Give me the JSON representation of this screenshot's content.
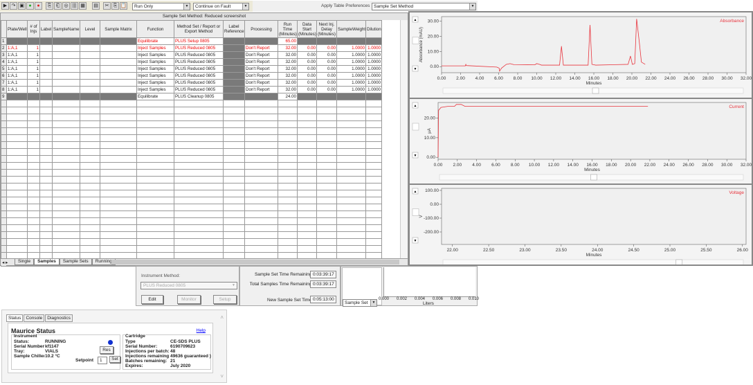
{
  "toolbar": {
    "icons": [
      "start-icon",
      "step-icon",
      "save-icon",
      "go-green-icon",
      "stop-red-icon",
      "copy-icon",
      "paste-row-icon",
      "find-icon",
      "columns-icon",
      "grid-icon",
      "calculator-icon",
      "cut-icon",
      "copy2-icon",
      "paste-icon"
    ],
    "run_mode": "Run Only",
    "fault_mode": "Continue on Fault",
    "apply_prefs_label": "Apply Table Preferences",
    "prefs_value": "Sample Set Method"
  },
  "table": {
    "title": "Sample Set Method: Reduced screenshot",
    "columns": [
      "",
      "Plate/Well",
      "# of Injs",
      "Label",
      "SampleName",
      "Level",
      "Sample Matrix",
      "Function",
      "Method Set / Report or Export Method",
      "Label Reference",
      "Processing",
      "Run Time (Minutes)",
      "Data Start (Minutes)",
      "Next Inj. Delay (Minutes)",
      "SampleWeight",
      "Dilution"
    ],
    "rows": [
      {
        "n": "1",
        "well": "",
        "inj": "",
        "func": "Equilibrate",
        "method": "PLUS Setup 0805",
        "proc": "",
        "run": "65.00",
        "start": "",
        "delay": "",
        "weight": "",
        "dil": "",
        "style": "equil-red"
      },
      {
        "n": "2",
        "well": "1:A,1",
        "inj": "1",
        "func": "Inject Samples",
        "method": "PLUS Reduced 0805",
        "proc": "Don't Report",
        "run": "32.00",
        "start": "0.00",
        "delay": "0.00",
        "weight": "1.0000",
        "dil": "1.0000",
        "style": "red"
      },
      {
        "n": "3",
        "well": "1:A,1",
        "inj": "1",
        "func": "Inject Samples",
        "method": "PLUS Reduced 0805",
        "proc": "Don't Report",
        "run": "32.00",
        "start": "0.00",
        "delay": "0.00",
        "weight": "1.0000",
        "dil": "1.0000",
        "style": ""
      },
      {
        "n": "4",
        "well": "1:A,1",
        "inj": "1",
        "func": "Inject Samples",
        "method": "PLUS Reduced 0805",
        "proc": "Don't Report",
        "run": "32.00",
        "start": "0.00",
        "delay": "0.00",
        "weight": "1.0000",
        "dil": "1.0000",
        "style": ""
      },
      {
        "n": "5",
        "well": "1:A,1",
        "inj": "1",
        "func": "Inject Samples",
        "method": "PLUS Reduced 0805",
        "proc": "Don't Report",
        "run": "32.00",
        "start": "0.00",
        "delay": "0.00",
        "weight": "1.0000",
        "dil": "1.0000",
        "style": ""
      },
      {
        "n": "6",
        "well": "1:A,1",
        "inj": "1",
        "func": "Inject Samples",
        "method": "PLUS Reduced 0805",
        "proc": "Don't Report",
        "run": "32.00",
        "start": "0.00",
        "delay": "0.00",
        "weight": "1.0000",
        "dil": "1.0000",
        "style": ""
      },
      {
        "n": "7",
        "well": "1:A,1",
        "inj": "1",
        "func": "Inject Samples",
        "method": "PLUS Reduced 0805",
        "proc": "Don't Report",
        "run": "32.00",
        "start": "0.00",
        "delay": "0.00",
        "weight": "1.0000",
        "dil": "1.0000",
        "style": ""
      },
      {
        "n": "8",
        "well": "1:A,1",
        "inj": "1",
        "func": "Inject Samples",
        "method": "PLUS Reduced 0805",
        "proc": "Don't Report",
        "run": "32.00",
        "start": "0.00",
        "delay": "0.00",
        "weight": "1.0000",
        "dil": "1.0000",
        "style": ""
      },
      {
        "n": "9",
        "well": "",
        "inj": "",
        "func": "Equilibrate",
        "method": "PLUS Cleanup 0805",
        "proc": "",
        "run": "24.00",
        "start": "",
        "delay": "",
        "weight": "",
        "dil": "",
        "style": "equil"
      }
    ],
    "sheet_tabs": [
      "Single",
      "Samples",
      "Sample Sets",
      "Running"
    ],
    "active_tab": "Samples"
  },
  "instrument": {
    "method_label": "Instrument Method:",
    "method_value": "PLUS Reduced 0805",
    "edit": "Edit",
    "monitor": "Monitor",
    "setup": "Setup",
    "set_time_label": "Sample Set Time Remaining:",
    "set_time": "0:03:39:17",
    "total_time_label": "Total Samples Time Remaining:",
    "total_time": "0:03:39:17",
    "new_time_label": "New Sample Set Time:",
    "new_time": "0:05:13:00",
    "volume_select": "Sample Set",
    "volume_ticks": [
      "0.000",
      "0.002",
      "0.004",
      "0.006",
      "0.008",
      "0.010"
    ],
    "volume_axis": "Liters"
  },
  "status": {
    "tabs": [
      "Status",
      "Console",
      "Diagnostics"
    ],
    "title": "Maurice Status",
    "help": "Help",
    "instrument_heading": "Instrument",
    "instrument": [
      [
        "Status:",
        "RUNNING"
      ],
      [
        "Serial Number:",
        "kf1147"
      ],
      [
        "Tray:",
        "VIALS"
      ],
      [
        "Sample Chiller:",
        "10.2 °C"
      ]
    ],
    "status_color": "#1030d0",
    "res": "Res",
    "setpoint_label": "Setpoint",
    "setpoint_value": "1",
    "set": "Set",
    "cartridge_heading": "Cartridge",
    "cartridge": [
      [
        "Type",
        "CE-SDS PLUS"
      ],
      [
        "Serial Number:",
        "6190709623"
      ],
      [
        "Injections per batch:",
        "48"
      ],
      [
        "Injections remaining:",
        "49636 guaranteed )"
      ],
      [
        "Batches remaining:",
        "21"
      ],
      [
        "Expires:",
        "July 2020"
      ]
    ]
  },
  "chart_data": [
    {
      "type": "line",
      "series": [
        {
          "name": "Absorbance",
          "x": [
            0,
            2.5,
            2.55,
            2.6,
            5.8,
            6.05,
            6.1,
            6.3,
            6.8,
            7.2,
            7.6,
            9.8,
            10,
            10.3,
            10.5,
            12.4,
            12.6,
            12.8,
            15.4,
            15.6,
            15.8,
            16.2,
            19.6,
            19.85,
            20.05,
            20.3,
            20.5,
            20.8,
            21,
            21.4
          ],
          "y": [
            0.5,
            0.5,
            1.5,
            0.7,
            -0.3,
            -1,
            -3,
            -1,
            1.5,
            2,
            1.3,
            1.2,
            2,
            1.5,
            1,
            1,
            13.5,
            1,
            1,
            27.5,
            1.5,
            1,
            1.5,
            7,
            1.5,
            2,
            31.5,
            15,
            3,
            1.5
          ]
        }
      ],
      "xlabel": "Minutes",
      "ylabel": "Absorbance (mAU)",
      "xlim": [
        0,
        32
      ],
      "ylim": [
        -4,
        33
      ],
      "xticks": [
        "0.00",
        "2.00",
        "4.00",
        "6.00",
        "8.00",
        "10.00",
        "12.00",
        "14.00",
        "16.00",
        "18.00",
        "20.00",
        "22.00",
        "24.00",
        "26.00",
        "28.00",
        "30.00",
        "32.00"
      ],
      "yticks": [
        "0.00",
        "10.00",
        "20.00",
        "30.00"
      ],
      "color": "#e8333c"
    },
    {
      "type": "line",
      "series": [
        {
          "name": "Current",
          "x": [
            0,
            0.05,
            0.3,
            1,
            1.7,
            1.9,
            2.4,
            2.8,
            21.8
          ],
          "y": [
            0,
            24,
            25.5,
            26,
            26,
            27,
            27,
            26,
            26
          ]
        }
      ],
      "xlabel": "Minutes",
      "ylabel": "µA",
      "xlim": [
        0,
        32
      ],
      "ylim": [
        -1,
        28
      ],
      "xticks": [
        "0.00",
        "2.00",
        "4.00",
        "6.00",
        "8.00",
        "10.00",
        "12.00",
        "14.00",
        "16.00",
        "18.00",
        "20.00",
        "22.00",
        "24.00",
        "26.00",
        "28.00",
        "30.00",
        "32.00"
      ],
      "yticks": [
        "0.00",
        "10.00",
        "20.00"
      ],
      "color": "#e8333c"
    },
    {
      "type": "line",
      "series": [
        {
          "name": "Voltage",
          "x": [],
          "y": []
        }
      ],
      "xlabel": "Minutes",
      "ylabel": "V",
      "xlim": [
        21.85,
        26.05
      ],
      "ylim": [
        -290,
        115
      ],
      "xticks": [
        "22.00",
        "22.50",
        "23.00",
        "23.50",
        "24.00",
        "24.50",
        "25.00",
        "25.50",
        "26.00"
      ],
      "yticks": [
        "-200.00",
        "-100.00",
        "0.00",
        "100.00"
      ],
      "color": "#e8333c"
    }
  ]
}
